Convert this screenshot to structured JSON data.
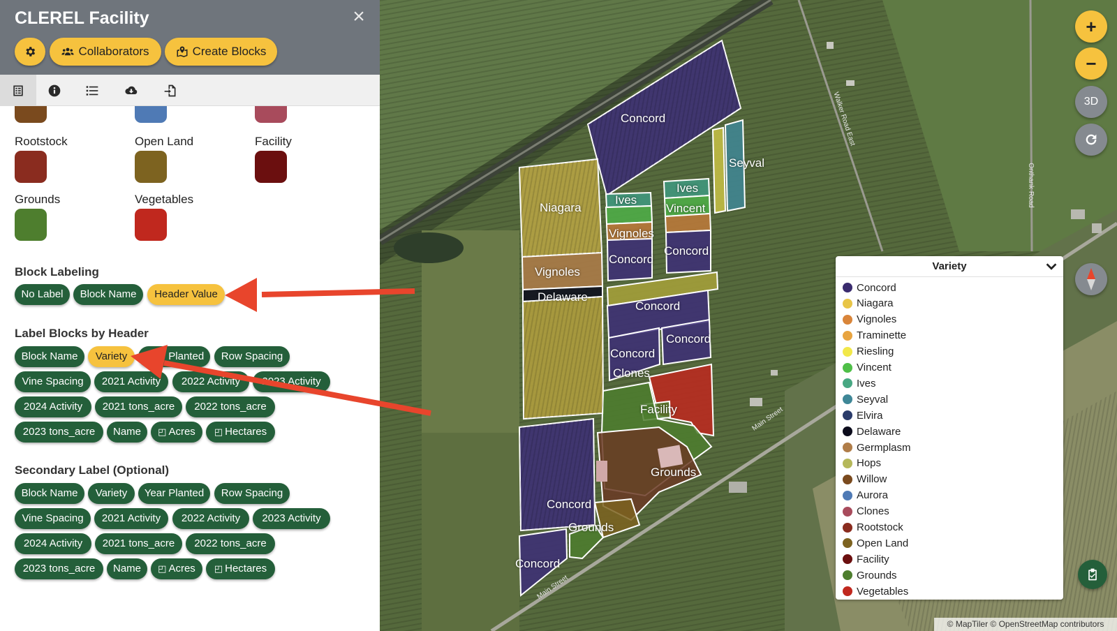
{
  "panel": {
    "title": "CLEREL Facility",
    "close_icon": "×",
    "buttons": {
      "collaborators": "Collaborators",
      "create_blocks": "Create Blocks"
    }
  },
  "swatches": {
    "top_partial": [
      {
        "color": "#7a4a1e"
      },
      {
        "color": "#4f7ab5"
      },
      {
        "color": "#a84b5c"
      }
    ],
    "rows": [
      {
        "label": "Rootstock",
        "color": "#8a2c1f"
      },
      {
        "label": "Open Land",
        "color": "#7d6320"
      },
      {
        "label": "Facility",
        "color": "#6b0f0f"
      },
      {
        "label": "Grounds",
        "color": "#4e7e2e"
      },
      {
        "label": "Vegetables",
        "color": "#c0281e"
      }
    ]
  },
  "block_labeling": {
    "title": "Block Labeling",
    "options": [
      "No Label",
      "Block Name",
      "Header Value"
    ],
    "active": "Header Value"
  },
  "label_by_header": {
    "title": "Label Blocks by Header",
    "options": [
      "Block Name",
      "Variety",
      "Year Planted",
      "Row Spacing",
      "Vine Spacing",
      "2021 Activity",
      "2022 Activity",
      "2023 Activity",
      "2024 Activity",
      "2021 tons_acre",
      "2022 tons_acre",
      "2023 tons_acre",
      "Name",
      "Acres",
      "Hectares"
    ],
    "active": "Variety"
  },
  "secondary_label": {
    "title": "Secondary Label (Optional)",
    "options": [
      "Block Name",
      "Variety",
      "Year Planted",
      "Row Spacing",
      "Vine Spacing",
      "2021 Activity",
      "2022 Activity",
      "2023 Activity",
      "2024 Activity",
      "2021 tons_acre",
      "2022 tons_acre",
      "2023 tons_acre",
      "Name",
      "Acres",
      "Hectares"
    ]
  },
  "map": {
    "controls": {
      "zoom_in": "+",
      "zoom_out": "−",
      "view_3d": "3D"
    },
    "block_labels": [
      "Concord",
      "Seyval",
      "Niagara",
      "Ives",
      "Ives",
      "Vincent",
      "Vignoles",
      "Concord",
      "Concord",
      "Vignoles",
      "Delaware",
      "Concord",
      "Concord",
      "Concord",
      "Clones",
      "Facility",
      "Grounds",
      "Concord",
      "Grounds",
      "Concord"
    ],
    "road_labels": [
      "Walker Road East",
      "Onthank Road",
      "Main Street",
      "Main Street"
    ],
    "attribution": "© MapTiler © OpenStreetMap contributors"
  },
  "legend": {
    "title": "Variety",
    "items": [
      {
        "name": "Concord",
        "color": "#3a2b6e"
      },
      {
        "name": "Niagara",
        "color": "#e8c547"
      },
      {
        "name": "Vignoles",
        "color": "#d9853a"
      },
      {
        "name": "Traminette",
        "color": "#e8a440"
      },
      {
        "name": "Riesling",
        "color": "#f2e84a"
      },
      {
        "name": "Vincent",
        "color": "#4fbf48"
      },
      {
        "name": "Ives",
        "color": "#48a883"
      },
      {
        "name": "Seyval",
        "color": "#3f8797"
      },
      {
        "name": "Elvira",
        "color": "#2a3b6a"
      },
      {
        "name": "Delaware",
        "color": "#0c0c1c"
      },
      {
        "name": "Germplasm",
        "color": "#b07d49"
      },
      {
        "name": "Hops",
        "color": "#b5b85a"
      },
      {
        "name": "Willow",
        "color": "#7a4a1e"
      },
      {
        "name": "Aurora",
        "color": "#4f7ab5"
      },
      {
        "name": "Clones",
        "color": "#a84b5c"
      },
      {
        "name": "Rootstock",
        "color": "#8a2c1f"
      },
      {
        "name": "Open Land",
        "color": "#7d6320"
      },
      {
        "name": "Facility",
        "color": "#6b0f0f"
      },
      {
        "name": "Grounds",
        "color": "#4e7e2e"
      },
      {
        "name": "Vegetables",
        "color": "#c0281e"
      }
    ]
  },
  "colors": {
    "accent": "#f6c23e",
    "chip": "#245f3a",
    "arrow": "#e8452c",
    "header": "#6f757c"
  }
}
